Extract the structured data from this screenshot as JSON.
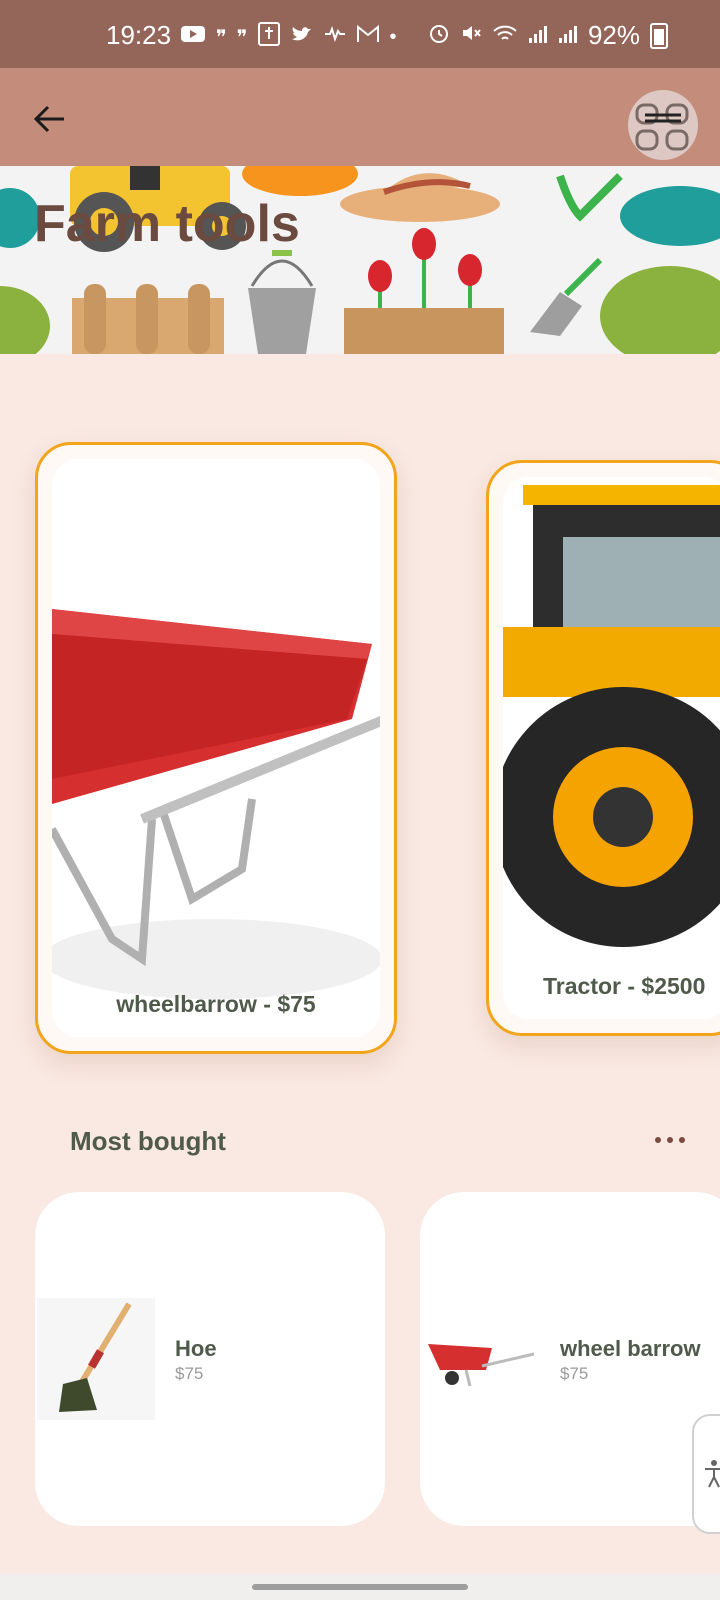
{
  "status_bar": {
    "time": "19:23",
    "battery": "92%",
    "icons": [
      "youtube-icon",
      "quote-icon",
      "quote-icon",
      "bible-icon",
      "twitter-icon",
      "signal-wave-icon",
      "gmail-icon",
      "dot-icon",
      "alarm-icon",
      "mute-icon",
      "wifi-icon",
      "signal-icon",
      "signal-icon",
      "battery-icon"
    ]
  },
  "app_bar": {
    "back_icon": "arrow-left-icon",
    "menu_icon": "menu-icon"
  },
  "banner": {
    "title": "Farm tools"
  },
  "featured": [
    {
      "label": "wheelbarrow - $75"
    },
    {
      "label": "Tractor - $2500"
    }
  ],
  "most_bought": {
    "title": "Most bought",
    "more_icon": "more-horizontal-icon",
    "items": [
      {
        "name": "Hoe",
        "price": "$75"
      },
      {
        "name": "wheel barrow",
        "price": "$75"
      }
    ]
  },
  "colors": {
    "status_bar": "#94665a",
    "app_bar": "#c48c7b",
    "background": "#f9e9e2",
    "card_border": "#f2a51c",
    "title_brown": "#6b4a40",
    "text_green": "#4f5a4b"
  }
}
